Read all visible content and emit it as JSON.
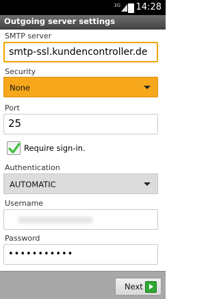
{
  "status": {
    "time": "14:28",
    "network": "3G"
  },
  "title": "Outgoing server settings",
  "smtp": {
    "label": "SMTP server",
    "value": "smtp-ssl.kundencontroller.de"
  },
  "security": {
    "label": "Security",
    "value": "None"
  },
  "port": {
    "label": "Port",
    "value": "25"
  },
  "signin": {
    "label": "Require sign-in.",
    "checked": true
  },
  "auth": {
    "label": "Authentication",
    "value": "AUTOMATIC"
  },
  "username": {
    "label": "Username"
  },
  "password": {
    "label": "Password",
    "value": "•••••••••••"
  },
  "next": {
    "label": "Next"
  },
  "colors": {
    "accent": "#f7a71b",
    "check": "#3fbf3a",
    "next_icon": "#2fa833"
  }
}
